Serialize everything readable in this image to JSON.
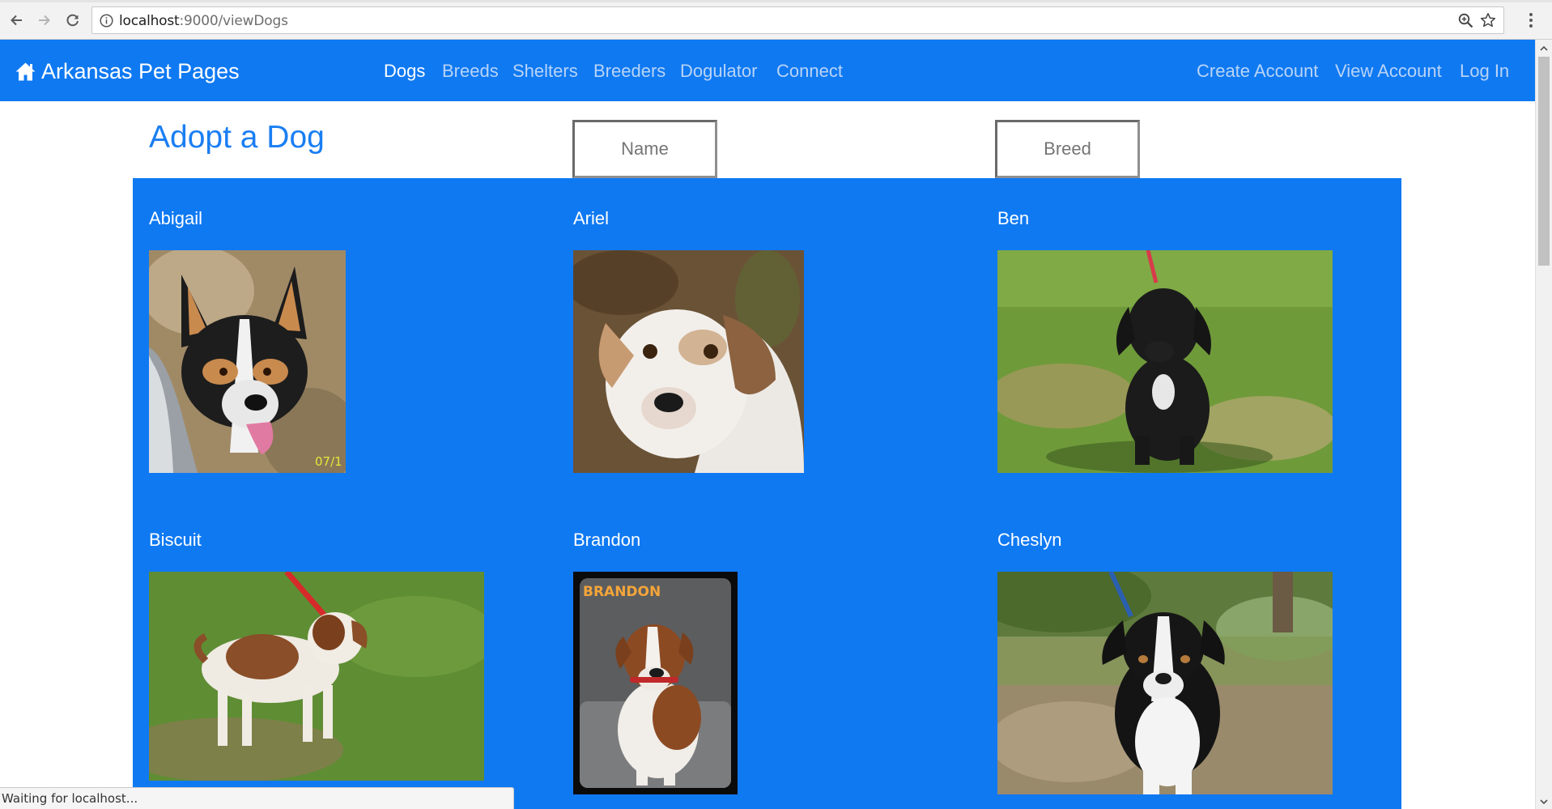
{
  "browser": {
    "url_host": "localhost",
    "url_path": ":9000/viewDogs",
    "status_text": "Waiting for localhost..."
  },
  "navbar": {
    "brand": "Arkansas Pet Pages",
    "links": [
      {
        "label": "Dogs",
        "active": true
      },
      {
        "label": "Breeds",
        "active": false
      },
      {
        "label": "Shelters",
        "active": false
      },
      {
        "label": "Breeders",
        "active": false
      },
      {
        "label": "Dogulator",
        "active": false
      },
      {
        "label": "Connect",
        "active": false
      }
    ],
    "account_links": [
      "Create Account",
      "View Account",
      "Log In"
    ]
  },
  "page": {
    "title": "Adopt a Dog",
    "name_placeholder": "Name",
    "breed_placeholder": "Breed"
  },
  "dogs": [
    {
      "name": "Abigail"
    },
    {
      "name": "Ariel"
    },
    {
      "name": "Ben"
    },
    {
      "name": "Biscuit"
    },
    {
      "name": "Brandon",
      "photo_caption": "BRANDON"
    },
    {
      "name": "Cheslyn"
    }
  ],
  "colors": {
    "brand_blue": "#0f79f2",
    "title_blue": "#1a7ef3",
    "inactive_link": "#b8d4f7"
  }
}
